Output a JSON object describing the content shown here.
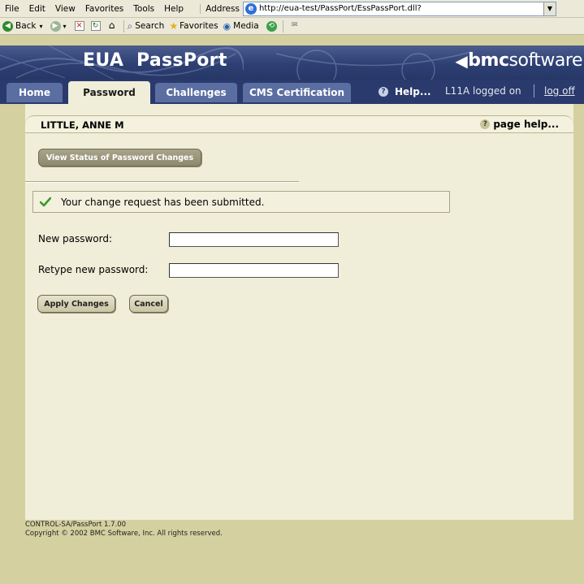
{
  "browser": {
    "menu": [
      "File",
      "Edit",
      "View",
      "Favorites",
      "Tools",
      "Help"
    ],
    "address_label": "Address",
    "url": "http://eua-test/PassPort/EssPassPort.dll?",
    "toolbar": {
      "back": "Back",
      "search": "Search",
      "favorites": "Favorites",
      "media": "Media"
    }
  },
  "app": {
    "title": "EUA  PassPort",
    "brand_bold": "bmc",
    "brand_light": "software"
  },
  "tabs": {
    "home": "Home",
    "password": "Password",
    "challenges": "Challenges",
    "cms": "CMS Certification",
    "help": "Help...",
    "logged_on": "L11A logged on",
    "log_off": "log off"
  },
  "main": {
    "user_name": "LITTLE, ANNE M",
    "page_help": "page help...",
    "view_status_button": "View Status of Password Changes",
    "status_message": "Your change request has been submitted.",
    "new_password_label": "New password:",
    "retype_password_label": "Retype new password:",
    "apply_button": "Apply Changes",
    "cancel_button": "Cancel"
  },
  "footer": {
    "version": "CONTROL-SA/PassPort 1.7.00",
    "copyright": "Copyright © 2002 BMC Software, Inc. All rights reserved."
  }
}
